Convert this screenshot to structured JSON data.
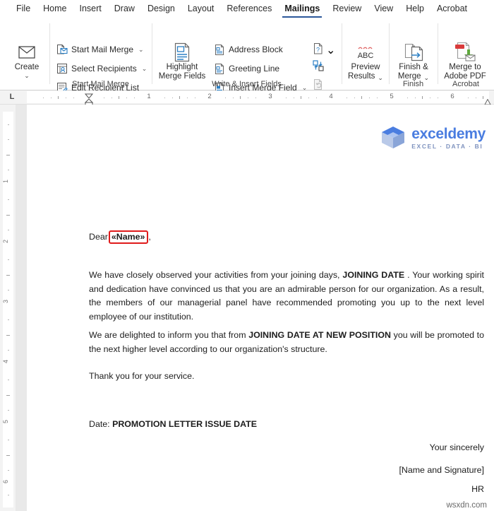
{
  "tabs": [
    {
      "label": "File",
      "active": false
    },
    {
      "label": "Home",
      "active": false
    },
    {
      "label": "Insert",
      "active": false
    },
    {
      "label": "Draw",
      "active": false
    },
    {
      "label": "Design",
      "active": false
    },
    {
      "label": "Layout",
      "active": false
    },
    {
      "label": "References",
      "active": false
    },
    {
      "label": "Mailings",
      "active": true
    },
    {
      "label": "Review",
      "active": false
    },
    {
      "label": "View",
      "active": false
    },
    {
      "label": "Help",
      "active": false
    },
    {
      "label": "Acrobat",
      "active": false
    }
  ],
  "ribbon": {
    "groups": [
      {
        "name": "create",
        "label": ""
      },
      {
        "name": "start-mail-merge",
        "label": "Start Mail Merge"
      },
      {
        "name": "write-insert-fields",
        "label": "Write & Insert Fields"
      },
      {
        "name": "preview-results",
        "label": ""
      },
      {
        "name": "finish",
        "label": "Finish"
      },
      {
        "name": "acrobat",
        "label": "Acrobat"
      }
    ],
    "create": {
      "label": "Create",
      "icon": "envelope-icon",
      "caret": "⌄"
    },
    "start_mail_merge": {
      "group_label": "Start Mail Merge",
      "items": [
        {
          "label": "Start Mail Merge",
          "icon": "start-mail-merge-icon",
          "caret": "⌄"
        },
        {
          "label": "Select Recipients",
          "icon": "select-recipients-icon",
          "caret": "⌄"
        },
        {
          "label": "Edit Recipient List",
          "icon": "edit-recipient-list-icon",
          "caret": ""
        }
      ]
    },
    "write_insert": {
      "group_label": "Write & Insert Fields",
      "highlight": {
        "label_line1": "Highlight",
        "label_line2": "Merge Fields",
        "icon": "highlight-merge-fields-icon"
      },
      "items": [
        {
          "label": "Address Block",
          "icon": "address-block-icon",
          "caret": ""
        },
        {
          "label": "Greeting Line",
          "icon": "greeting-line-icon",
          "caret": ""
        },
        {
          "label": "Insert Merge Field",
          "icon": "insert-merge-field-icon",
          "caret": "⌄"
        }
      ],
      "small_icons": [
        {
          "name": "rules-icon",
          "caret": "⌄",
          "disabled": false
        },
        {
          "name": "match-fields-icon",
          "caret": "",
          "disabled": false
        },
        {
          "name": "update-labels-icon",
          "caret": "",
          "disabled": true
        }
      ]
    },
    "preview": {
      "label_line1": "Preview",
      "label_line2": "Results",
      "icon": "abc-preview-icon",
      "icon_text": "ABC",
      "caret": "⌄"
    },
    "finish": {
      "group_label": "Finish",
      "label_line1": "Finish &",
      "label_line2": "Merge",
      "icon": "finish-and-merge-icon",
      "caret": "⌄"
    },
    "acrobat": {
      "group_label": "Acrobat",
      "label_line1": "Merge to",
      "label_line2": "Adobe PDF",
      "icon": "merge-to-adobe-pdf-icon"
    }
  },
  "ruler": {
    "tab_selector": "L",
    "horizontal_numbers": [
      "1",
      "2",
      "3",
      "4",
      "5",
      "6"
    ],
    "vertical_numbers": [
      "1",
      "2",
      "3",
      "4",
      "5",
      "6"
    ]
  },
  "document": {
    "logo": {
      "word": "exceldemy",
      "subtitle": "EXCEL · DATA · BI",
      "mark": "exceldemy-cube-logo"
    },
    "salutation_prefix": "Dear",
    "merge_field": "«Name»",
    "salutation_suffix": ",",
    "paragraph1_a": "We have closely observed your activities from your joining days, ",
    "paragraph1_field": "JOINING DATE",
    "paragraph1_b": " . Your working spirit and dedication have convinced us that you are an admirable person for our organization. As a result, the members of our managerial panel have recommended promoting you up to the next level employee of our institution.",
    "paragraph2_a": "We are delighted to inform you that from ",
    "paragraph2_field": "JOINING DATE AT NEW POSITION",
    "paragraph2_b": "  you will be promoted to the next higher level according to our organization's structure.",
    "paragraph3": "Thank you for your service.",
    "date_label": "Date:",
    "date_field": "PROMOTION LETTER ISSUE DATE",
    "closing1": "Your sincerely",
    "closing2": "[Name and Signature]",
    "closing3": "HR"
  },
  "watermark": "wsxdn.com",
  "colors": {
    "accent": "#2b579a",
    "merge_field_outline": "#e01b1b",
    "logo_blue": "#4a7de0",
    "logo_sub": "#7f93bf",
    "pdf_red": "#d93b3b",
    "pdf_green": "#5faa3c"
  }
}
